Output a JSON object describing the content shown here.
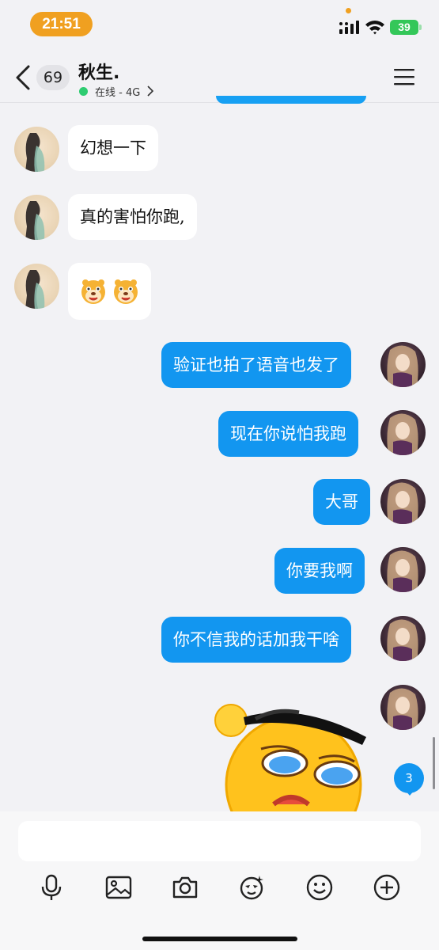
{
  "status_bar": {
    "time": "21:51",
    "battery": "39"
  },
  "header": {
    "unread_count": "69",
    "contact_name": "秋生.",
    "status_text": "在线 - 4G"
  },
  "messages": [
    {
      "side": "in",
      "text": "幻想一下"
    },
    {
      "side": "in",
      "text": "真的害怕你跑,"
    },
    {
      "side": "in",
      "text": "",
      "emoji": "tiger-face"
    },
    {
      "side": "out",
      "text": "验证也拍了语音也发了"
    },
    {
      "side": "out",
      "text": "现在你说怕我跑"
    },
    {
      "side": "out",
      "text": "大哥"
    },
    {
      "side": "out",
      "text": "你要我啊"
    },
    {
      "side": "out",
      "text": "你不信我的话加我干啥"
    },
    {
      "side": "out",
      "text": "",
      "sticker": "yellow-face-sunglasses"
    }
  ],
  "new_message_badge": "3",
  "input": {
    "value": ""
  },
  "toolbar": [
    "mic-icon",
    "image-icon",
    "camera-icon",
    "sticker-icon",
    "emoji-icon",
    "plus-icon"
  ],
  "colors": {
    "accent": "#1296f0",
    "time_pill": "#f0a020",
    "online": "#2ecc71"
  }
}
